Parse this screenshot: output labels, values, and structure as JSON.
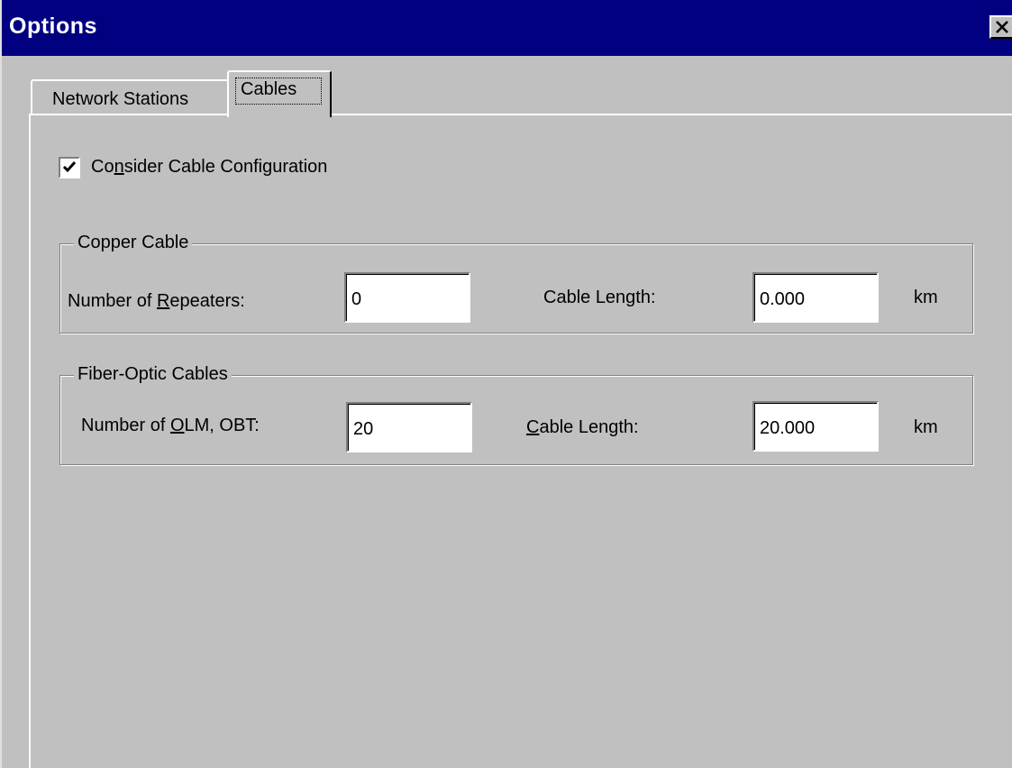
{
  "window": {
    "title": "Options",
    "close_label": "×"
  },
  "tabs": [
    {
      "label": "Network Stations",
      "selected": false
    },
    {
      "label": "Cables",
      "selected": true
    }
  ],
  "consider_cable": {
    "label_prefix": "Co",
    "label_mnemonic": "n",
    "label_suffix": "sider Cable Configuration",
    "checked": true
  },
  "copper": {
    "legend": "Copper Cable",
    "repeaters_label_prefix": "Number of ",
    "repeaters_label_mnemonic": "R",
    "repeaters_label_suffix": "epeaters:",
    "repeaters_value": "0",
    "length_label": "Cable Length:",
    "length_value": "0.000",
    "unit": "km"
  },
  "fiber": {
    "legend": "Fiber-Optic Cables",
    "olm_label_prefix": "Number of ",
    "olm_label_mnemonic": "O",
    "olm_label_suffix": "LM, OBT:",
    "olm_value": "20",
    "length_label_mnemonic": "C",
    "length_label_suffix": "able Length:",
    "length_value": "20.000",
    "unit": "km"
  },
  "colors": {
    "titlebar": "#000080",
    "face": "#c0c0c0"
  }
}
